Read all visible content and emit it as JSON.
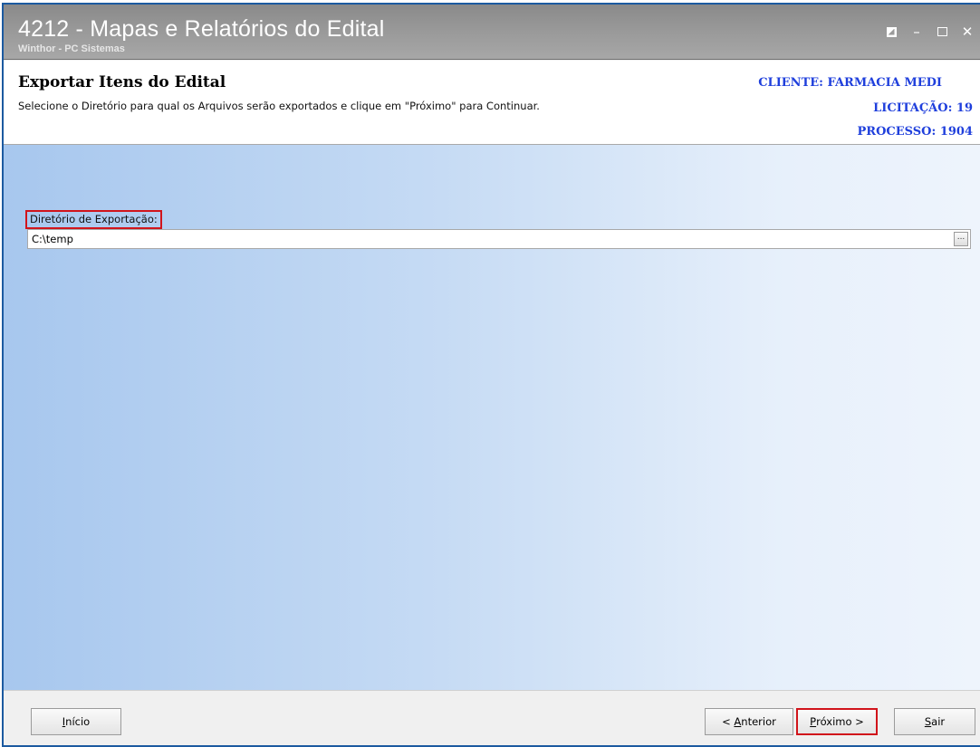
{
  "window": {
    "title": "4212 - Mapas e Relatórios do Edital",
    "subtitle": "Winthor - PC Sistemas"
  },
  "header": {
    "title": "Exportar Itens do Edital",
    "description": "Selecione o Diretório para qual os Arquivos serão exportados e clique em \"Próximo\" para Continuar.",
    "cliente": "CLIENTE: FARMACIA MEDI",
    "licitacao": "LICITAÇÃO: 19",
    "processo": "PROCESSO: 1904"
  },
  "form": {
    "directory_label": "Diretório de Exportação:",
    "directory_value": "C:\\temp",
    "browse_label": "..."
  },
  "footer": {
    "inicio": {
      "mnemonic": "I",
      "rest": "nício"
    },
    "anterior": {
      "prefix": "< ",
      "mnemonic": "A",
      "rest": "nterior"
    },
    "proximo": {
      "mnemonic": "P",
      "rest": "róximo >"
    },
    "sair": {
      "mnemonic": "S",
      "rest": "air"
    }
  },
  "colors": {
    "accent_blue": "#1f3fdc",
    "highlight_red": "#d1141b",
    "titlebar_gray": "#9b9b9b"
  },
  "icons": [
    "restore-icon",
    "minimize-icon",
    "maximize-icon",
    "close-icon"
  ]
}
